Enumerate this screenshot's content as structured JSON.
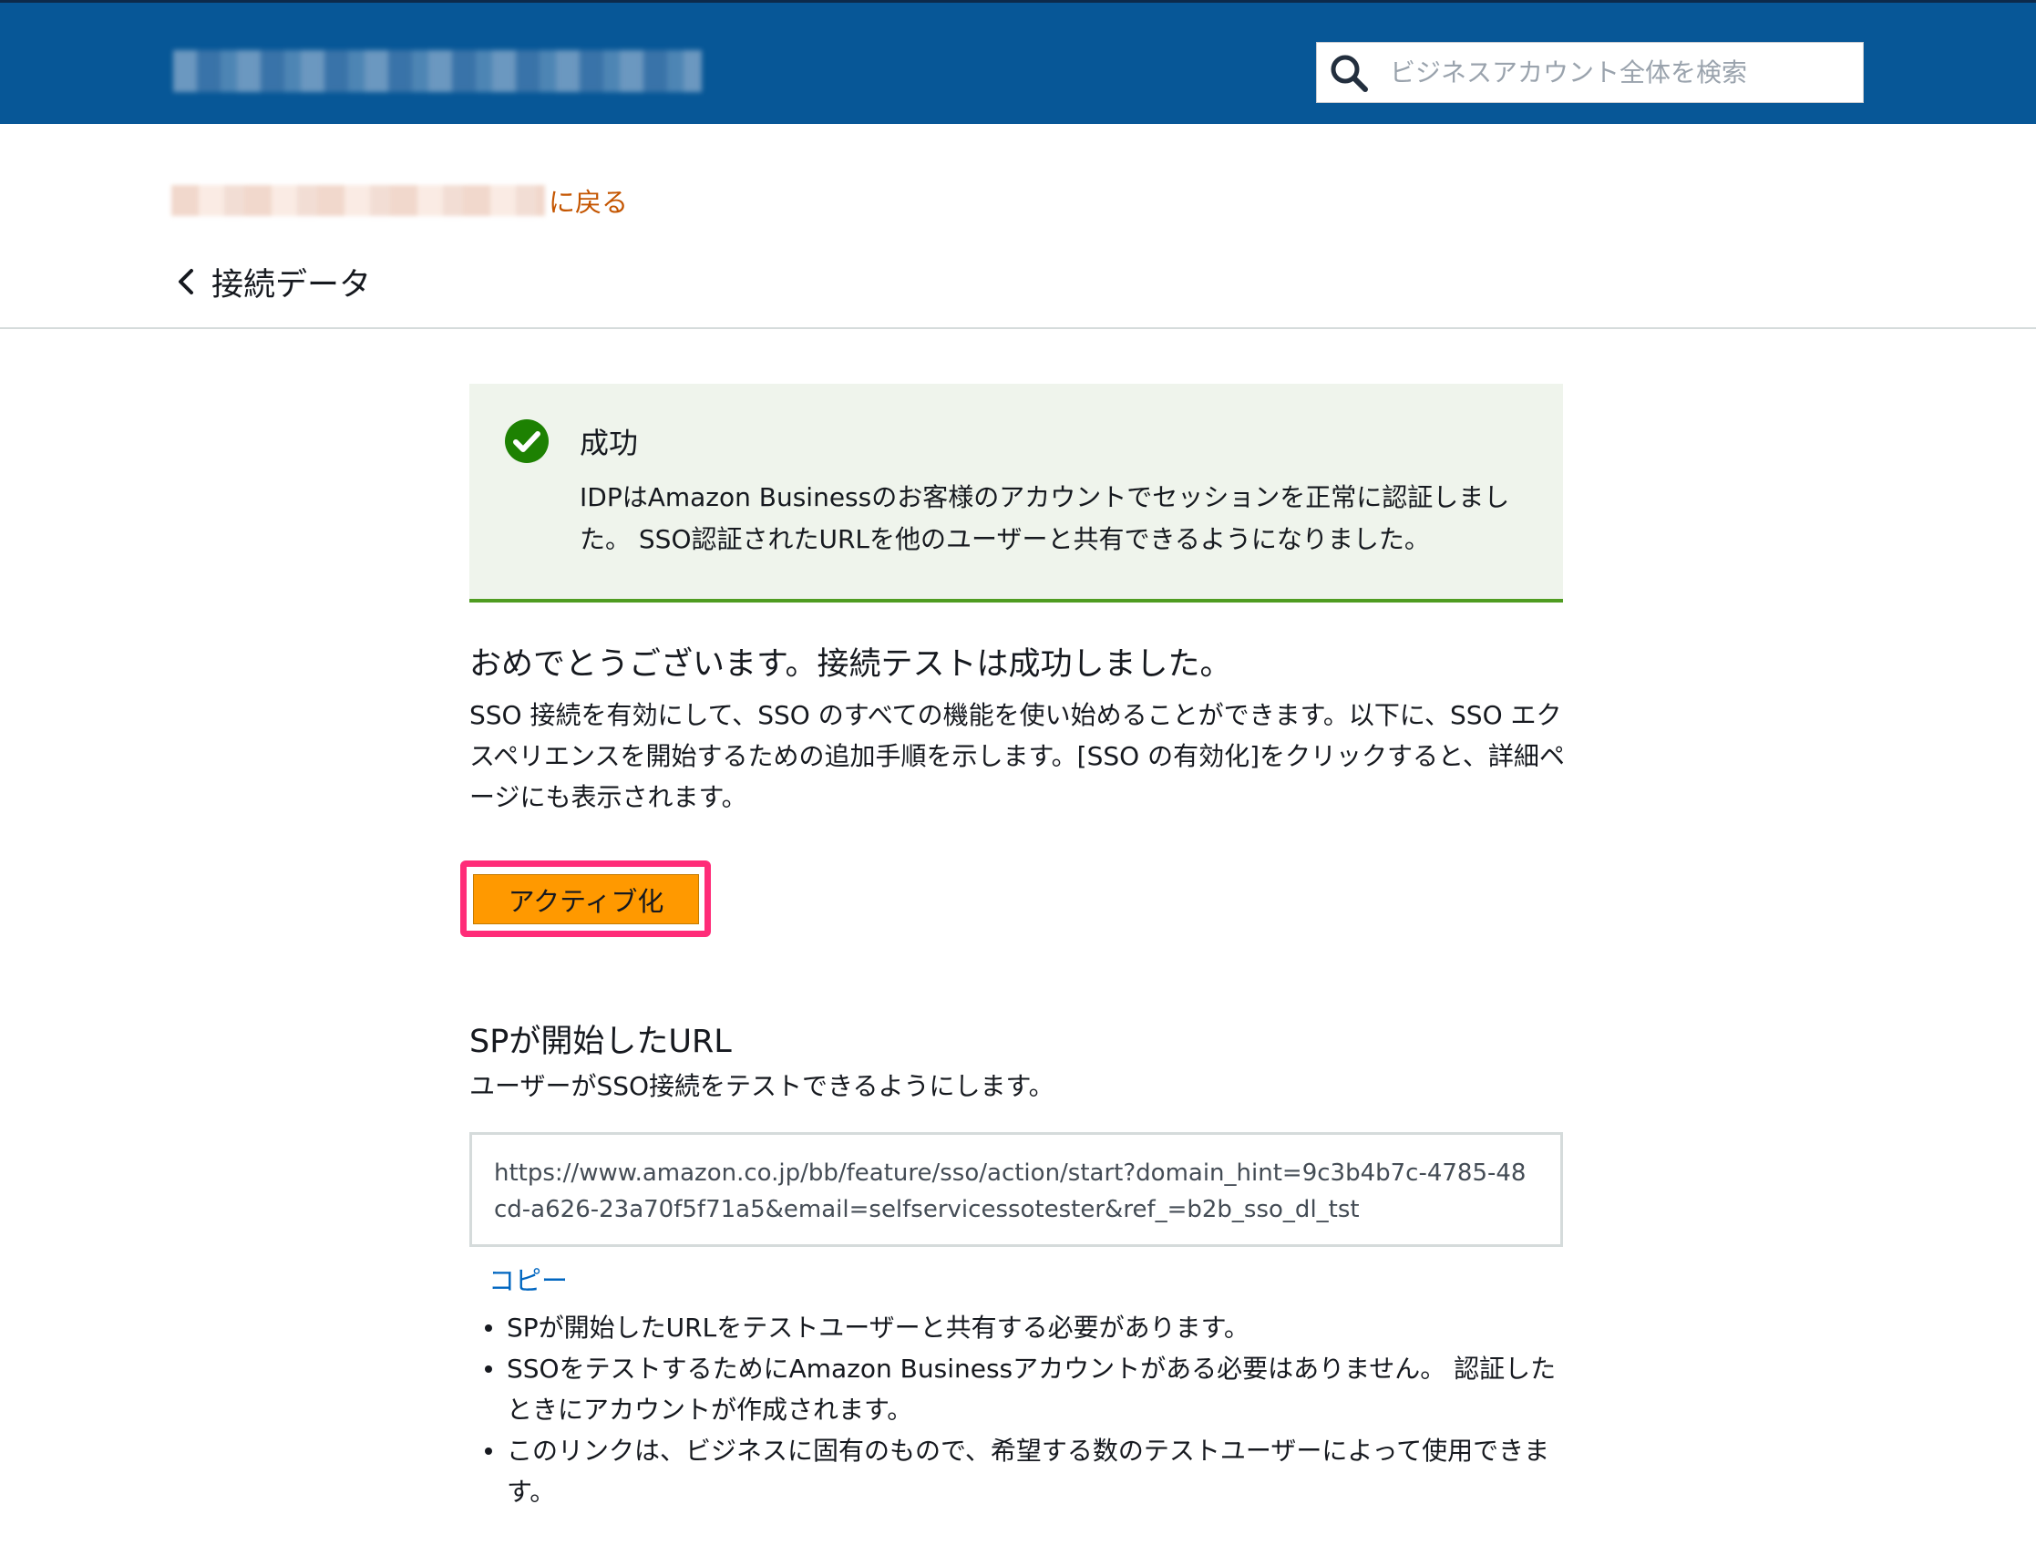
{
  "header": {
    "search": {
      "placeholder": "ビジネスアカウント全体を検索",
      "icon": "search-icon"
    }
  },
  "breadcrumb": {
    "back_link_suffix": "に戻る",
    "current": "接続データ"
  },
  "alert": {
    "title": "成功",
    "body": "IDPはAmazon Businessのお客様のアカウントでセッションを正常に認証しました。 SSO認証されたURLを他のユーザーと共有できるようになりました。",
    "accent_color": "#4f9c21"
  },
  "congrats": {
    "title": "おめでとうございます。接続テストは成功しました。",
    "body": "SSO 接続を有効にして、SSO のすべての機能を使い始めることができます。以下に、SSO エクスペリエンスを開始するための追加手順を示します。[SSO の有効化]をクリックすると、詳細ページにも表示されます。"
  },
  "activate": {
    "label": "アクティブ化",
    "color": "#ff9900",
    "highlight_color": "#ff2c78"
  },
  "sp_url": {
    "title": "SPが開始したURL",
    "description": "ユーザーがSSO接続をテストできるようにします。",
    "url": "https://www.amazon.co.jp/bb/feature/sso/action/start?domain_hint=9c3b4b7c-4785-48cd-a626-23a70f5f71a5&email=selfservicessotester&ref_=b2b_sso_dl_tst",
    "copy_label": "コピー"
  },
  "notes": [
    "SPが開始したURLをテストユーザーと共有する必要があります。",
    "SSOをテストするためにAmazon Businessアカウントがある必要はありません。 認証したときにアカウントが作成されます。",
    "このリンクは、ビジネスに固有のもので、希望する数のテストユーザーによって使用できます。"
  ],
  "colors": {
    "header_bg": "#075797",
    "link_orange": "#c45500",
    "link_blue": "#0066c0"
  }
}
